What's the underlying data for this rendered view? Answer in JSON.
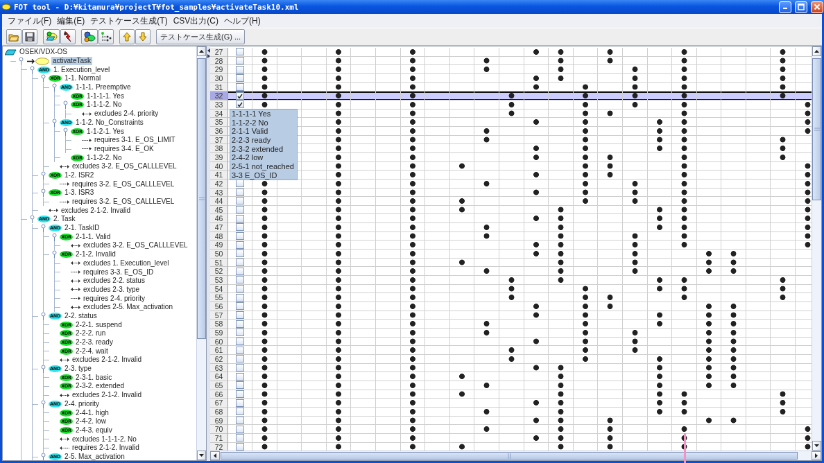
{
  "window": {
    "title": "FOT tool - D:¥kitamura¥projectT¥fot_samples¥activateTask10.xml"
  },
  "menu": [
    "ファイル(F)",
    "編集(E)",
    "テストケース生成(T)",
    "CSV出力(C)",
    "ヘルプ(H)"
  ],
  "toolbar": {
    "button": "テストケース生成(G) ..."
  },
  "tree": {
    "kind": "root",
    "label": "OSEK/VDX-OS",
    "selected": false,
    "children": [
      {
        "kind": "task",
        "label": "activateTask",
        "selected": true,
        "expanded": true,
        "children": [
          {
            "kind": "and",
            "badge": "AND",
            "label": "1. Execution_level",
            "selected": false,
            "expanded": true,
            "children": [
              {
                "kind": "xor",
                "badge": "XOR",
                "label": "1-1. Normal",
                "selected": false,
                "expanded": true,
                "children": [
                  {
                    "kind": "and",
                    "badge": "AND",
                    "label": "1-1-1. Preemptive",
                    "selected": false,
                    "expanded": true,
                    "children": [
                      {
                        "kind": "xor",
                        "badge": "XOR",
                        "label": "1-1-1-1. Yes",
                        "selected": false
                      },
                      {
                        "kind": "xor",
                        "badge": "XOR",
                        "label": "1-1-1-2. No",
                        "selected": false,
                        "expanded": true,
                        "children": [
                          {
                            "kind": "excludes",
                            "label": "excludes 2-4. priority",
                            "selected": false
                          }
                        ]
                      }
                    ]
                  },
                  {
                    "kind": "and",
                    "badge": "AND",
                    "label": "1-1-2. No_Constraints",
                    "selected": false,
                    "expanded": true,
                    "children": [
                      {
                        "kind": "xor",
                        "badge": "XOR",
                        "label": "1-1-2-1. Yes",
                        "selected": false,
                        "expanded": true,
                        "children": [
                          {
                            "kind": "requires",
                            "label": "requires 3-1. E_OS_LIMIT",
                            "selected": false
                          },
                          {
                            "kind": "requires",
                            "label": "requires 3-4. E_OK",
                            "selected": false
                          }
                        ]
                      },
                      {
                        "kind": "xor",
                        "badge": "XOR",
                        "label": "1-1-2-2. No",
                        "selected": false
                      }
                    ]
                  },
                  {
                    "kind": "excludes",
                    "label": "excludes 3-2. E_OS_CALLLEVEL",
                    "selected": false
                  }
                ]
              },
              {
                "kind": "xor",
                "badge": "XOR",
                "label": "1-2. ISR2",
                "selected": false,
                "expanded": true,
                "children": [
                  {
                    "kind": "requires",
                    "label": "requires 3-2. E_OS_CALLLEVEL",
                    "selected": false
                  }
                ]
              },
              {
                "kind": "xor",
                "badge": "XOR",
                "label": "1-3. ISR3",
                "selected": false,
                "expanded": true,
                "children": [
                  {
                    "kind": "requires",
                    "label": "requires 3-2. E_OS_CALLLEVEL",
                    "selected": false
                  }
                ]
              },
              {
                "kind": "excludes",
                "label": "excludes 2-1-2. Invalid",
                "selected": false
              }
            ]
          },
          {
            "kind": "and",
            "badge": "AND",
            "label": "2. Task",
            "selected": false,
            "expanded": true,
            "children": [
              {
                "kind": "and",
                "badge": "AND",
                "label": "2-1. TaskID",
                "selected": false,
                "expanded": true,
                "children": [
                  {
                    "kind": "xor",
                    "badge": "XOR",
                    "label": "2-1-1. Valid",
                    "selected": false,
                    "expanded": true,
                    "children": [
                      {
                        "kind": "excludes",
                        "label": "excludes 3-2. E_OS_CALLLEVEL",
                        "selected": false
                      }
                    ]
                  },
                  {
                    "kind": "xor",
                    "badge": "XOR",
                    "label": "2-1-2. Invalid",
                    "selected": false,
                    "expanded": true,
                    "children": [
                      {
                        "kind": "excludes",
                        "label": "excludes 1. Execution_level",
                        "selected": false
                      },
                      {
                        "kind": "requires",
                        "label": "requires 3-3. E_OS_ID",
                        "selected": false
                      },
                      {
                        "kind": "excludes",
                        "label": "excludes 2-2. status",
                        "selected": false
                      },
                      {
                        "kind": "excludes",
                        "label": "excludes 2-3. type",
                        "selected": false
                      },
                      {
                        "kind": "requires",
                        "label": "requires 2-4. priority",
                        "selected": false
                      },
                      {
                        "kind": "excludes",
                        "label": "excludes 2-5. Max_activation",
                        "selected": false
                      }
                    ]
                  }
                ]
              },
              {
                "kind": "and",
                "badge": "AND",
                "label": "2-2. status",
                "selected": false,
                "expanded": true,
                "children": [
                  {
                    "kind": "xor",
                    "badge": "XOR",
                    "label": "2-2-1. suspend",
                    "selected": false
                  },
                  {
                    "kind": "xor",
                    "badge": "XOR",
                    "label": "2-2-2. run",
                    "selected": false
                  },
                  {
                    "kind": "xor",
                    "badge": "XOR",
                    "label": "2-2-3. ready",
                    "selected": false
                  },
                  {
                    "kind": "xor",
                    "badge": "XOR",
                    "label": "2-2-4. wait",
                    "selected": false
                  },
                  {
                    "kind": "excludes",
                    "label": "excludes 2-1-2. Invalid",
                    "selected": false
                  }
                ]
              },
              {
                "kind": "and",
                "badge": "AND",
                "label": "2-3. type",
                "selected": false,
                "expanded": true,
                "children": [
                  {
                    "kind": "xor",
                    "badge": "XOR",
                    "label": "2-3-1. basic",
                    "selected": false
                  },
                  {
                    "kind": "xor",
                    "badge": "XOR",
                    "label": "2-3-2. extended",
                    "selected": false
                  },
                  {
                    "kind": "excludes",
                    "label": "excludes 2-1-2. Invalid",
                    "selected": false
                  }
                ]
              },
              {
                "kind": "and",
                "badge": "AND",
                "label": "2-4. priority",
                "selected": false,
                "expanded": true,
                "children": [
                  {
                    "kind": "xor",
                    "badge": "XOR",
                    "label": "2-4-1. high",
                    "selected": false
                  },
                  {
                    "kind": "xor",
                    "badge": "XOR",
                    "label": "2-4-2. low",
                    "selected": false
                  },
                  {
                    "kind": "xor",
                    "badge": "XOR",
                    "label": "2-4-3. equiv",
                    "selected": false
                  },
                  {
                    "kind": "excludes",
                    "label": "excludes 1-1-1-2. No",
                    "selected": false
                  },
                  {
                    "kind": "required_by",
                    "label": "requires 2-1-2. Invalid",
                    "selected": false
                  }
                ]
              },
              {
                "kind": "and",
                "badge": "AND",
                "label": "2-5. Max_activation",
                "selected": false,
                "expanded": true
              }
            ]
          }
        ]
      }
    ]
  },
  "table": {
    "rows": [
      {
        "number": "27",
        "selected": false,
        "checked": false,
        "cells": [
          true,
          false,
          false,
          true,
          false,
          false,
          true,
          false,
          false,
          false,
          false,
          true,
          true,
          false,
          true,
          false,
          false,
          true,
          false,
          false,
          false,
          true,
          false
        ]
      },
      {
        "number": "28",
        "selected": false,
        "checked": false,
        "cells": [
          true,
          false,
          false,
          true,
          false,
          false,
          true,
          false,
          false,
          true,
          false,
          false,
          true,
          false,
          true,
          false,
          false,
          true,
          false,
          false,
          false,
          true,
          false
        ]
      },
      {
        "number": "29",
        "selected": false,
        "checked": false,
        "cells": [
          true,
          false,
          false,
          true,
          false,
          false,
          true,
          false,
          false,
          true,
          false,
          false,
          true,
          false,
          false,
          true,
          false,
          true,
          false,
          false,
          false,
          true,
          false
        ]
      },
      {
        "number": "30",
        "selected": false,
        "checked": false,
        "cells": [
          true,
          false,
          false,
          true,
          false,
          false,
          true,
          false,
          false,
          false,
          false,
          true,
          true,
          false,
          false,
          true,
          false,
          true,
          false,
          false,
          false,
          true,
          false
        ]
      },
      {
        "number": "31",
        "selected": false,
        "checked": false,
        "cells": [
          true,
          false,
          false,
          true,
          false,
          false,
          true,
          false,
          false,
          false,
          false,
          true,
          false,
          true,
          false,
          true,
          false,
          true,
          false,
          false,
          false,
          true,
          false
        ]
      },
      {
        "number": "32",
        "selected": true,
        "checked": true,
        "cells": [
          true,
          false,
          false,
          true,
          false,
          false,
          true,
          false,
          false,
          false,
          true,
          false,
          false,
          true,
          false,
          true,
          false,
          true,
          false,
          false,
          false,
          true,
          false
        ]
      },
      {
        "number": "33",
        "selected": false,
        "checked": true,
        "cells": [
          true,
          false,
          false,
          true,
          false,
          false,
          true,
          false,
          false,
          false,
          true,
          false,
          false,
          true,
          false,
          true,
          false,
          true,
          false,
          false,
          false,
          false,
          true
        ]
      },
      {
        "number": "34",
        "selected": false,
        "cells": [
          null,
          false,
          false,
          true,
          false,
          false,
          true,
          false,
          false,
          false,
          true,
          false,
          false,
          true,
          true,
          false,
          false,
          true,
          false,
          false,
          false,
          false,
          true
        ]
      },
      {
        "number": "35",
        "selected": false,
        "cells": [
          null,
          false,
          false,
          true,
          false,
          false,
          true,
          false,
          false,
          false,
          false,
          true,
          false,
          true,
          false,
          false,
          true,
          true,
          false,
          false,
          false,
          false,
          true
        ]
      },
      {
        "number": "36",
        "selected": false,
        "cells": [
          null,
          false,
          false,
          true,
          false,
          false,
          true,
          false,
          false,
          true,
          false,
          false,
          false,
          true,
          false,
          false,
          true,
          true,
          false,
          false,
          false,
          false,
          true
        ]
      },
      {
        "number": "37",
        "selected": false,
        "cells": [
          null,
          false,
          false,
          true,
          false,
          false,
          true,
          false,
          false,
          true,
          false,
          false,
          false,
          true,
          false,
          false,
          true,
          true,
          false,
          false,
          false,
          true,
          false
        ]
      },
      {
        "number": "38",
        "selected": false,
        "cells": [
          null,
          false,
          false,
          true,
          false,
          false,
          true,
          false,
          false,
          false,
          false,
          true,
          false,
          true,
          false,
          false,
          true,
          true,
          false,
          false,
          false,
          true,
          false
        ]
      },
      {
        "number": "39",
        "selected": false,
        "cells": [
          null,
          false,
          false,
          true,
          false,
          false,
          true,
          false,
          false,
          false,
          false,
          true,
          false,
          true,
          true,
          false,
          false,
          true,
          false,
          false,
          false,
          true,
          false
        ]
      },
      {
        "number": "40",
        "selected": false,
        "cells": [
          null,
          false,
          false,
          true,
          false,
          false,
          true,
          false,
          true,
          false,
          false,
          false,
          false,
          true,
          true,
          false,
          false,
          true,
          false,
          false,
          false,
          false,
          true
        ]
      },
      {
        "number": "41",
        "selected": false,
        "cells": [
          null,
          false,
          false,
          true,
          false,
          false,
          true,
          false,
          false,
          false,
          false,
          true,
          false,
          true,
          true,
          false,
          false,
          true,
          false,
          false,
          false,
          false,
          true
        ]
      },
      {
        "number": "42",
        "selected": false,
        "checked": false,
        "cells": [
          true,
          false,
          false,
          true,
          false,
          false,
          true,
          false,
          false,
          true,
          false,
          false,
          false,
          true,
          false,
          true,
          false,
          true,
          false,
          false,
          false,
          false,
          true
        ]
      },
      {
        "number": "43",
        "selected": false,
        "checked": false,
        "cells": [
          true,
          false,
          false,
          true,
          false,
          false,
          true,
          false,
          false,
          false,
          false,
          true,
          false,
          true,
          false,
          true,
          false,
          true,
          false,
          false,
          false,
          false,
          true
        ]
      },
      {
        "number": "44",
        "selected": false,
        "checked": false,
        "cells": [
          true,
          false,
          false,
          true,
          false,
          false,
          true,
          false,
          true,
          false,
          false,
          false,
          false,
          true,
          false,
          true,
          false,
          true,
          false,
          false,
          false,
          false,
          true
        ]
      },
      {
        "number": "45",
        "selected": false,
        "checked": false,
        "cells": [
          true,
          false,
          false,
          true,
          false,
          false,
          true,
          false,
          true,
          false,
          false,
          false,
          true,
          false,
          false,
          false,
          true,
          true,
          false,
          false,
          false,
          false,
          true
        ]
      },
      {
        "number": "46",
        "selected": false,
        "checked": false,
        "cells": [
          true,
          false,
          false,
          true,
          false,
          false,
          true,
          false,
          false,
          false,
          false,
          true,
          true,
          false,
          false,
          false,
          true,
          true,
          false,
          false,
          false,
          false,
          true
        ]
      },
      {
        "number": "47",
        "selected": false,
        "checked": false,
        "cells": [
          true,
          false,
          false,
          true,
          false,
          false,
          true,
          false,
          false,
          true,
          false,
          false,
          true,
          false,
          false,
          false,
          true,
          true,
          false,
          false,
          false,
          false,
          true
        ]
      },
      {
        "number": "48",
        "selected": false,
        "checked": false,
        "cells": [
          true,
          false,
          false,
          true,
          false,
          false,
          true,
          false,
          false,
          true,
          false,
          false,
          true,
          false,
          false,
          true,
          false,
          true,
          false,
          false,
          false,
          false,
          true
        ]
      },
      {
        "number": "49",
        "selected": false,
        "checked": false,
        "cells": [
          true,
          false,
          false,
          true,
          false,
          false,
          true,
          false,
          false,
          false,
          false,
          true,
          true,
          false,
          false,
          true,
          false,
          true,
          false,
          false,
          false,
          false,
          true
        ]
      },
      {
        "number": "50",
        "selected": false,
        "checked": false,
        "cells": [
          true,
          false,
          false,
          true,
          false,
          false,
          true,
          false,
          false,
          false,
          false,
          true,
          true,
          false,
          false,
          true,
          false,
          false,
          true,
          true,
          false,
          false,
          false
        ]
      },
      {
        "number": "51",
        "selected": false,
        "checked": false,
        "cells": [
          true,
          false,
          false,
          true,
          false,
          false,
          true,
          false,
          true,
          false,
          false,
          false,
          true,
          false,
          false,
          true,
          false,
          false,
          true,
          true,
          false,
          false,
          false
        ]
      },
      {
        "number": "52",
        "selected": false,
        "checked": false,
        "cells": [
          true,
          false,
          false,
          true,
          false,
          false,
          true,
          false,
          false,
          true,
          false,
          false,
          true,
          false,
          false,
          true,
          false,
          false,
          true,
          true,
          false,
          false,
          false
        ]
      },
      {
        "number": "53",
        "selected": false,
        "checked": false,
        "cells": [
          true,
          false,
          false,
          true,
          false,
          false,
          true,
          false,
          false,
          false,
          true,
          false,
          true,
          false,
          false,
          false,
          true,
          true,
          false,
          false,
          false,
          true,
          false
        ]
      },
      {
        "number": "54",
        "selected": false,
        "checked": false,
        "cells": [
          true,
          false,
          false,
          true,
          false,
          false,
          true,
          false,
          false,
          false,
          true,
          false,
          false,
          true,
          false,
          false,
          true,
          true,
          false,
          false,
          false,
          true,
          false
        ]
      },
      {
        "number": "55",
        "selected": false,
        "checked": false,
        "cells": [
          true,
          false,
          false,
          true,
          false,
          false,
          true,
          false,
          false,
          false,
          true,
          false,
          false,
          true,
          true,
          false,
          false,
          true,
          false,
          false,
          false,
          true,
          false
        ]
      },
      {
        "number": "56",
        "selected": false,
        "checked": false,
        "cells": [
          true,
          false,
          false,
          true,
          false,
          false,
          true,
          false,
          false,
          false,
          false,
          true,
          false,
          true,
          true,
          false,
          false,
          false,
          true,
          true,
          false,
          false,
          false
        ]
      },
      {
        "number": "57",
        "selected": false,
        "checked": false,
        "cells": [
          true,
          false,
          false,
          true,
          false,
          false,
          true,
          false,
          false,
          false,
          false,
          true,
          false,
          true,
          false,
          false,
          true,
          false,
          true,
          true,
          false,
          false,
          false
        ]
      },
      {
        "number": "58",
        "selected": false,
        "checked": false,
        "cells": [
          true,
          false,
          false,
          true,
          false,
          false,
          true,
          false,
          false,
          true,
          false,
          false,
          false,
          true,
          false,
          false,
          true,
          false,
          true,
          true,
          false,
          false,
          false
        ]
      },
      {
        "number": "59",
        "selected": false,
        "checked": false,
        "cells": [
          true,
          false,
          false,
          true,
          false,
          false,
          true,
          false,
          false,
          true,
          false,
          false,
          false,
          true,
          false,
          true,
          false,
          false,
          true,
          true,
          false,
          false,
          false
        ]
      },
      {
        "number": "60",
        "selected": false,
        "checked": false,
        "cells": [
          true,
          false,
          false,
          true,
          false,
          false,
          true,
          false,
          false,
          false,
          false,
          true,
          false,
          true,
          false,
          true,
          false,
          false,
          true,
          true,
          false,
          false,
          false
        ]
      },
      {
        "number": "61",
        "selected": false,
        "checked": false,
        "cells": [
          true,
          false,
          false,
          true,
          false,
          false,
          true,
          false,
          false,
          false,
          true,
          false,
          false,
          true,
          false,
          true,
          false,
          false,
          true,
          true,
          false,
          false,
          false
        ]
      },
      {
        "number": "62",
        "selected": false,
        "checked": false,
        "cells": [
          true,
          false,
          false,
          true,
          false,
          false,
          true,
          false,
          false,
          false,
          true,
          false,
          false,
          true,
          false,
          false,
          true,
          false,
          true,
          true,
          false,
          false,
          false
        ]
      },
      {
        "number": "63",
        "selected": false,
        "checked": false,
        "cells": [
          true,
          false,
          false,
          true,
          false,
          false,
          true,
          false,
          false,
          false,
          false,
          true,
          true,
          false,
          false,
          false,
          true,
          false,
          true,
          true,
          false,
          false,
          false
        ]
      },
      {
        "number": "64",
        "selected": false,
        "checked": false,
        "cells": [
          true,
          false,
          false,
          true,
          false,
          false,
          true,
          false,
          true,
          false,
          false,
          false,
          true,
          false,
          false,
          false,
          true,
          false,
          true,
          true,
          false,
          false,
          false
        ]
      },
      {
        "number": "65",
        "selected": false,
        "checked": false,
        "cells": [
          true,
          false,
          false,
          true,
          false,
          false,
          true,
          false,
          false,
          true,
          false,
          false,
          true,
          false,
          false,
          false,
          true,
          false,
          true,
          true,
          false,
          false,
          false
        ]
      },
      {
        "number": "66",
        "selected": false,
        "checked": false,
        "cells": [
          true,
          false,
          false,
          true,
          false,
          false,
          true,
          false,
          true,
          false,
          false,
          false,
          true,
          false,
          false,
          false,
          true,
          true,
          false,
          false,
          false,
          true,
          false
        ]
      },
      {
        "number": "67",
        "selected": false,
        "checked": false,
        "cells": [
          true,
          false,
          false,
          true,
          false,
          false,
          true,
          false,
          false,
          false,
          false,
          true,
          true,
          false,
          false,
          false,
          true,
          true,
          false,
          false,
          false,
          true,
          false
        ]
      },
      {
        "number": "68",
        "selected": false,
        "checked": false,
        "cells": [
          true,
          false,
          false,
          true,
          false,
          false,
          true,
          false,
          false,
          true,
          false,
          false,
          true,
          false,
          false,
          false,
          true,
          true,
          false,
          false,
          false,
          true,
          false
        ]
      },
      {
        "number": "69",
        "selected": false,
        "checked": false,
        "cells": [
          true,
          false,
          false,
          true,
          false,
          false,
          true,
          false,
          false,
          false,
          false,
          true,
          true,
          false,
          true,
          false,
          false,
          false,
          true,
          true,
          false,
          false,
          false
        ]
      },
      {
        "number": "70",
        "selected": false,
        "checked": false,
        "cells": [
          true,
          false,
          false,
          true,
          false,
          false,
          true,
          false,
          false,
          true,
          false,
          false,
          true,
          false,
          true,
          false,
          false,
          true,
          false,
          false,
          false,
          false,
          true
        ]
      },
      {
        "number": "71",
        "selected": false,
        "checked": false,
        "cells": [
          true,
          false,
          false,
          true,
          false,
          false,
          true,
          false,
          false,
          false,
          false,
          true,
          true,
          false,
          true,
          false,
          false,
          true,
          false,
          false,
          false,
          false,
          true
        ]
      },
      {
        "number": "72",
        "selected": false,
        "checked": false,
        "cells": [
          true,
          false,
          false,
          true,
          false,
          false,
          true,
          false,
          true,
          false,
          false,
          false,
          true,
          false,
          true,
          false,
          false,
          true,
          false,
          false,
          false,
          false,
          true
        ]
      }
    ]
  },
  "tooltip": {
    "lines": [
      "1-1-1-1 Yes",
      "1-1-2-2 No",
      "2-1-1 Valid",
      "2-2-3 ready",
      "2-3-2 extended",
      "2-4-2 low",
      "2-5-1 not_reached",
      "3-3 E_OS_ID"
    ]
  }
}
